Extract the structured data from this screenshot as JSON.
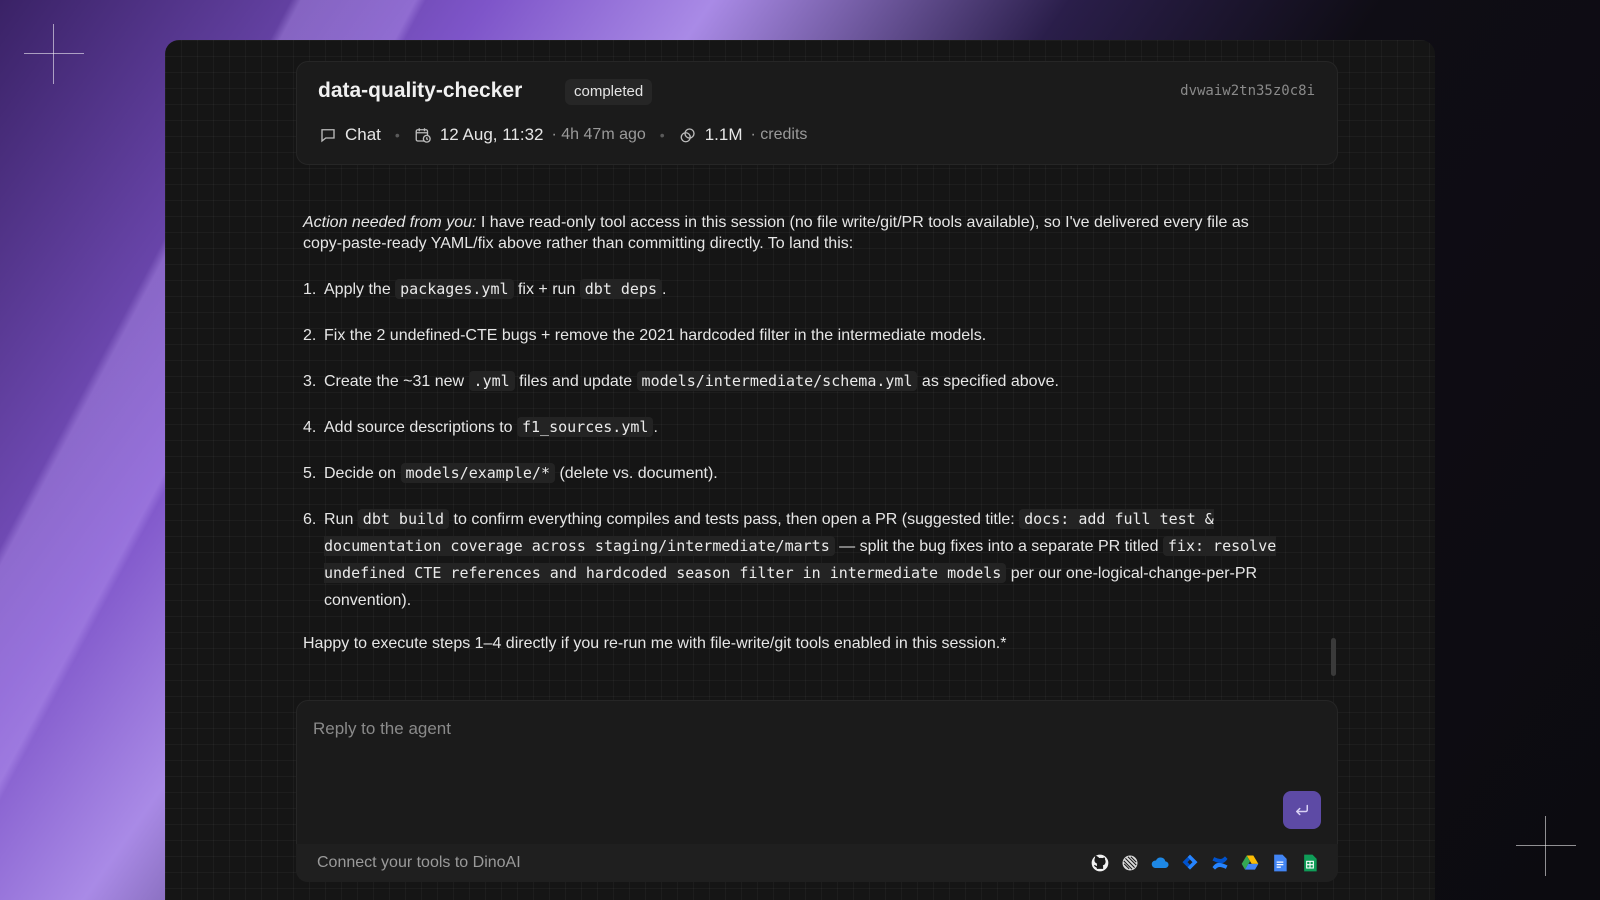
{
  "header": {
    "title": "data-quality-checker",
    "status": "completed",
    "job_id": "dvwaiw2tn35z0c8i",
    "mode": "Chat",
    "date": "12 Aug, 11:32",
    "relative_time": "· 4h 47m ago",
    "credits_value": "1.1M",
    "credits_label": "· credits"
  },
  "message": {
    "intro_emphasis": "Action needed from you:",
    "intro_text": " I have read-only tool access in this session (no file write/git/PR tools available), so I've delivered every file as copy-paste-ready YAML/fix above rather than committing directly. To land this:",
    "steps": [
      {
        "num": "1.",
        "t1": "Apply the ",
        "c1": "packages.yml",
        "t2": " fix + run ",
        "c2": "dbt deps",
        "t3": "."
      },
      {
        "num": "2.",
        "t1": "Fix the 2 undefined-CTE bugs + remove the 2021 hardcoded filter in the intermediate models."
      },
      {
        "num": "3.",
        "t1": "Create the ~31 new ",
        "c1": ".yml",
        "t2": " files and update ",
        "c2": "models/intermediate/schema.yml",
        "t3": " as specified above."
      },
      {
        "num": "4.",
        "t1": "Add source descriptions to ",
        "c1": "f1_sources.yml",
        "t2": "."
      },
      {
        "num": "5.",
        "t1": "Decide on ",
        "c1": "models/example/*",
        "t2": " (delete vs. document)."
      },
      {
        "num": "6.",
        "t1": "Run ",
        "c1": "dbt build",
        "t2": " to confirm everything compiles and tests pass, then open a PR (suggested title: ",
        "c2": "docs: add full test & documentation coverage across staging/intermediate/marts",
        "t3": " — split the bug fixes into a separate PR titled ",
        "c3": "fix: resolve undefined CTE references and hardcoded season filter in intermediate models",
        "t4": " per our one-logical-change-per-PR convention)."
      }
    ],
    "closing": "Happy to execute steps 1–4 directly if you re-run me with file-write/git tools enabled in this session.*"
  },
  "reply": {
    "placeholder": "Reply to the agent",
    "value": ""
  },
  "footer": {
    "connect_text": "Connect your tools to DinoAI",
    "tools": [
      "github-icon",
      "linear-icon",
      "onedrive-icon",
      "jira-icon",
      "confluence-icon",
      "google-drive-icon",
      "google-docs-icon",
      "google-sheets-icon"
    ]
  },
  "colors": {
    "accent": "#5d4aa5",
    "panel": "#151515",
    "card": "#1b1b1b"
  }
}
